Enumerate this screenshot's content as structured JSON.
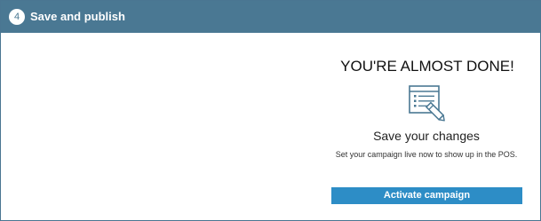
{
  "header": {
    "step_number": "4",
    "title": "Save and publish"
  },
  "main": {
    "headline": "YOU'RE ALMOST DONE!",
    "icon": "document-edit-icon",
    "subheading": "Save your changes",
    "description": "Set your campaign live now to show up in the POS.",
    "activate_label": "Activate campaign"
  },
  "colors": {
    "header_bg": "#4a7893",
    "button_bg": "#2d8dc6",
    "icon_stroke": "#4a7893"
  }
}
